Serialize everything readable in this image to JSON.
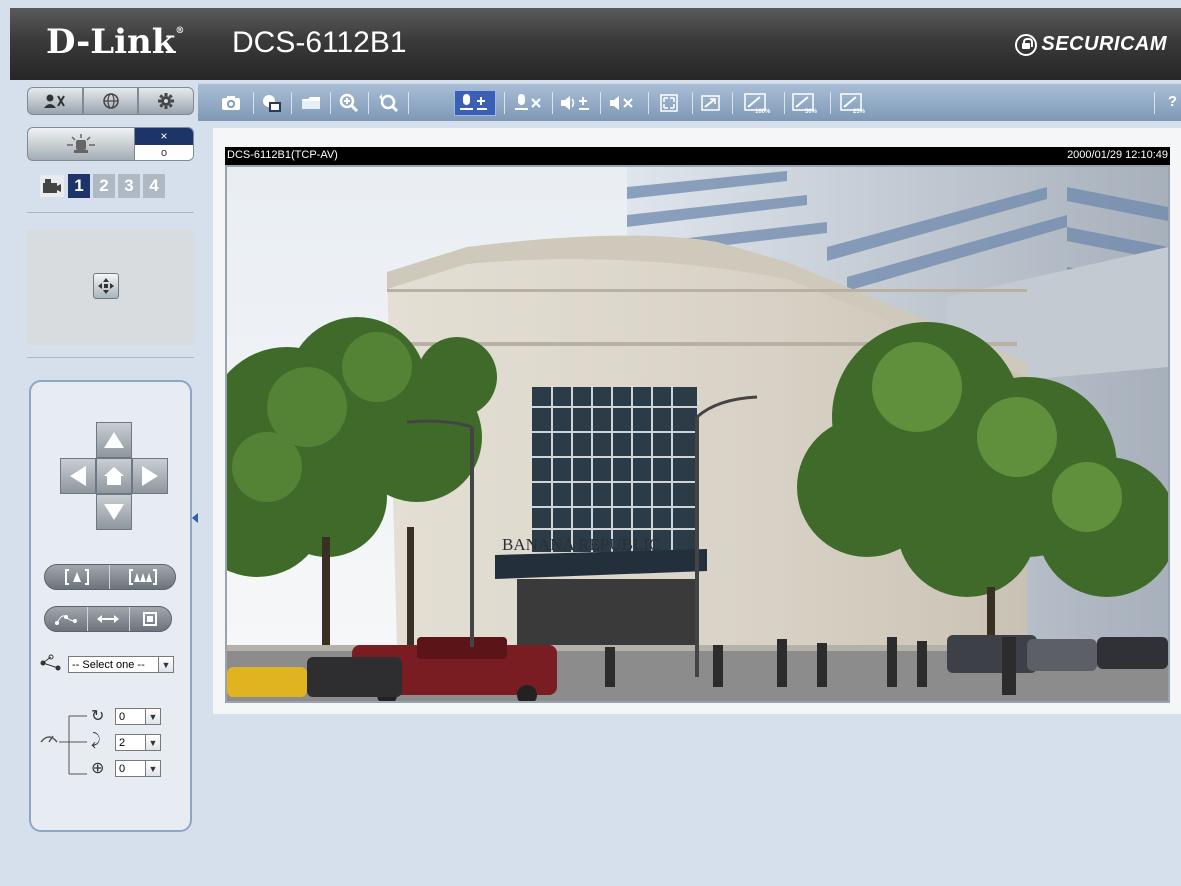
{
  "header": {
    "logo": "D-Link",
    "logo_mark": "®",
    "model": "DCS-6112B1",
    "brand": "SECURICAM"
  },
  "toolbar": {
    "buttons": [
      {
        "name": "snapshot",
        "icon": "camera-icon"
      },
      {
        "name": "record",
        "icon": "video-record-icon"
      },
      {
        "name": "folder",
        "icon": "folder-icon"
      },
      {
        "name": "digital-zoom",
        "icon": "zoom-icon"
      },
      {
        "name": "restore-zoom",
        "icon": "zoom-restore-icon"
      },
      {
        "name": "talk",
        "icon": "microphone-plus-icon"
      },
      {
        "name": "mic-mute",
        "icon": "microphone-mute-icon"
      },
      {
        "name": "volume",
        "icon": "speaker-plus-icon"
      },
      {
        "name": "speaker-mute",
        "icon": "speaker-mute-icon"
      },
      {
        "name": "fullscreen",
        "icon": "fullscreen-icon"
      },
      {
        "name": "resize",
        "icon": "resize-icon"
      },
      {
        "name": "size-100",
        "icon": "size-100-icon"
      },
      {
        "name": "size-50",
        "icon": "size-50-icon"
      },
      {
        "name": "size-25",
        "icon": "size-25-icon"
      }
    ],
    "help": "?"
  },
  "left": {
    "alarm_off": "×",
    "alarm_on": "o",
    "streams": [
      "1",
      "2",
      "3",
      "4"
    ],
    "selected_stream": "1",
    "preset_select": "-- Select one --",
    "speeds": [
      {
        "label": "pan",
        "icon": "pan-speed-icon",
        "value": "0"
      },
      {
        "label": "tilt",
        "icon": "tilt-speed-icon",
        "value": "2"
      },
      {
        "label": "zoom",
        "icon": "zoom-speed-icon",
        "value": "0"
      }
    ]
  },
  "video": {
    "stream_name": "DCS-6112B1(TCP-AV)",
    "timestamp": "2000/01/29 12:10:49",
    "store_sign": "BANANA REPUBLIC"
  },
  "colors": {
    "accent": "#1c3468",
    "toolbar": "#8ba4c1",
    "panel_border": "#8ea6c5",
    "background": "#d6e0ec"
  }
}
